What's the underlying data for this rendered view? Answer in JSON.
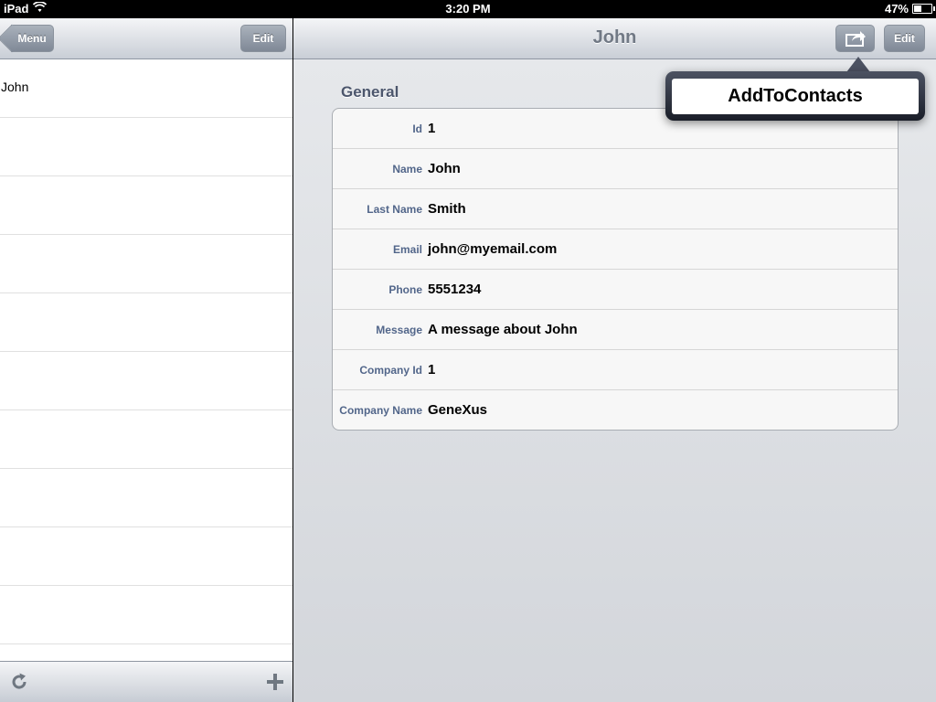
{
  "status_bar": {
    "device": "iPad",
    "time": "3:20 PM",
    "battery": "47%",
    "battery_level": 0.47
  },
  "master": {
    "back_label": "Menu",
    "edit_label": "Edit",
    "items": [
      {
        "label": "John"
      },
      {
        "label": ""
      },
      {
        "label": ""
      },
      {
        "label": ""
      },
      {
        "label": ""
      },
      {
        "label": ""
      },
      {
        "label": ""
      },
      {
        "label": ""
      },
      {
        "label": ""
      },
      {
        "label": ""
      }
    ],
    "toolbar": {
      "refresh_icon": "refresh-icon",
      "add_icon": "add-icon"
    }
  },
  "detail": {
    "title": "John",
    "action_icon": "share-icon",
    "edit_label": "Edit",
    "section_title": "General",
    "fields": [
      {
        "label": "Id",
        "value": "1"
      },
      {
        "label": "Name",
        "value": "John"
      },
      {
        "label": "Last Name",
        "value": "Smith"
      },
      {
        "label": "Email",
        "value": "john@myemail.com"
      },
      {
        "label": "Phone",
        "value": "5551234"
      },
      {
        "label": "Message",
        "value": "A message about John"
      },
      {
        "label": "Company Id",
        "value": "1"
      },
      {
        "label": "Company Name",
        "value": "GeneXus"
      }
    ]
  },
  "popover": {
    "items": [
      {
        "label": "AddToContacts"
      }
    ]
  }
}
